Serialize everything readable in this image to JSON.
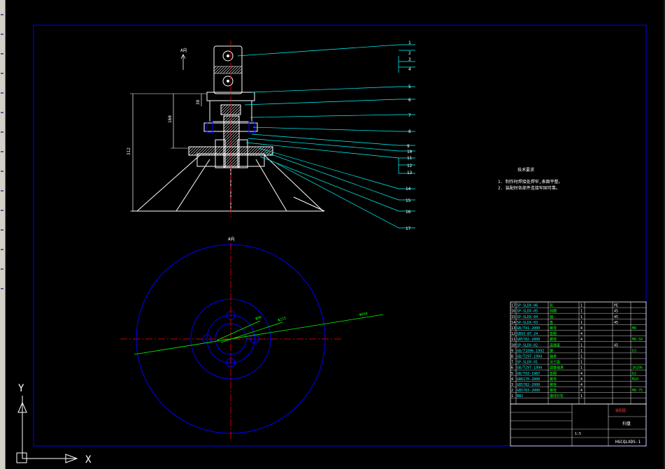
{
  "view_labels": {
    "section_top": "A向",
    "section_plan": "A向"
  },
  "dimensions": {
    "d1": "312",
    "d2": "160",
    "d3": "38"
  },
  "diameters": {
    "r1": "Φ96",
    "r2": "Φ215",
    "r3": "Φ850"
  },
  "part_numbers": [
    "1",
    "2",
    "3",
    "4",
    "5",
    "6",
    "7",
    "8",
    "9",
    "10",
    "11",
    "12",
    "13",
    "14",
    "15",
    "16",
    "17"
  ],
  "tech_requirements": {
    "title": "技术要求",
    "items": [
      "1. 制作时焊接处焊牢,表面平整。",
      "2. 装配时各部件连接牢固可靠。"
    ]
  },
  "bom": {
    "rows": [
      {
        "no": "17",
        "code": "SP-SLDX-06",
        "name": "轮",
        "qty": "1",
        "mat": "PE",
        "note": ""
      },
      {
        "no": "16",
        "code": "SP-SLDX-05",
        "name": "挡圈",
        "qty": "1",
        "mat": "45",
        "note": ""
      },
      {
        "no": "15",
        "code": "SP-SLDX-04",
        "name": "轴",
        "qty": "1",
        "mat": "45",
        "note": ""
      },
      {
        "no": "14",
        "code": "SP-SLDX-03",
        "name": "盘",
        "qty": "1",
        "mat": "45",
        "note": ""
      },
      {
        "no": "13",
        "code": "GB/T41-2000",
        "name": "螺母",
        "qty": "4",
        "mat": "",
        "note": "M8"
      },
      {
        "no": "12",
        "code": "GB93-87 24",
        "name": "垫圈",
        "qty": "4",
        "mat": "",
        "note": ""
      },
      {
        "no": "11",
        "code": "GB5782-2000",
        "name": "螺栓",
        "qty": "4",
        "mat": "",
        "note": "M8-50"
      },
      {
        "no": "10",
        "code": "SP-SLDX-02",
        "name": "连接座",
        "qty": "1",
        "mat": "45",
        "note": ""
      },
      {
        "no": "9",
        "code": "GB/T1096-1992",
        "name": "键",
        "qty": "1",
        "mat": "",
        "note": "D3"
      },
      {
        "no": "8",
        "code": "GB/T297-1994",
        "name": "轴承",
        "qty": "1",
        "mat": "",
        "note": ""
      },
      {
        "no": "7",
        "code": "SP-SLDX-01",
        "name": "法兰座",
        "qty": "1",
        "mat": "",
        "note": ""
      },
      {
        "no": "6",
        "code": "GB/T297-1994",
        "name": "圆锥轴承",
        "qty": "1",
        "mat": "",
        "note": "30206"
      },
      {
        "no": "5",
        "code": "GB/T93-1987",
        "name": "垫圈",
        "qty": "4",
        "mat": "",
        "note": "D2"
      },
      {
        "no": "4",
        "code": "GB6170-2000",
        "name": "螺母",
        "qty": "4",
        "mat": "",
        "note": "M20"
      },
      {
        "no": "3",
        "code": "GB5782-2000",
        "name": "螺栓",
        "qty": "4",
        "mat": "",
        "note": ""
      },
      {
        "no": "2",
        "code": "GB5783-2000",
        "name": "螺栓",
        "qty": "4",
        "mat": "",
        "note": "M8-75"
      },
      {
        "no": "1",
        "code": "BWJ",
        "name": "摆线针轮",
        "qty": "1",
        "mat": "",
        "note": ""
      }
    ],
    "header": [
      "序号",
      "代号",
      "名称",
      "数量",
      "材料",
      "单件",
      "总计",
      "备注"
    ],
    "title_block": {
      "drawing_title": "装配图",
      "part_name": "扫盘",
      "drawing_no": "HGCQLXDS-1",
      "scale": "1:5"
    }
  },
  "ucs": {
    "x_label": "X",
    "y_label": "Y"
  },
  "colors": {
    "frame": "#0000ff",
    "leader": "#00ffff",
    "dim": "#00ff00",
    "center": "#ff0000",
    "lines": "#ffffff"
  }
}
